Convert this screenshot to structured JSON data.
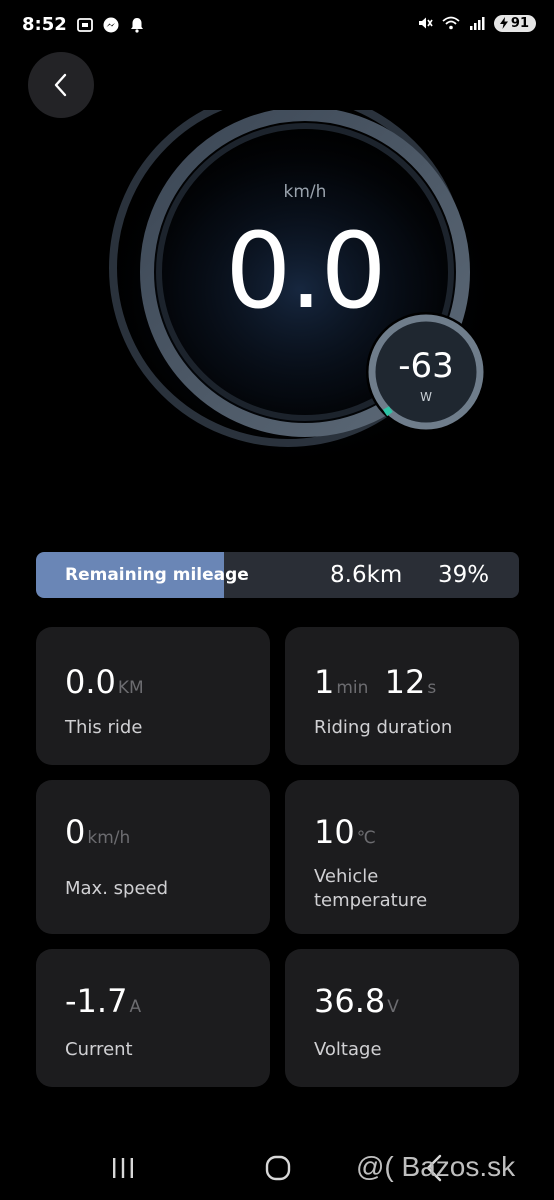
{
  "status_bar": {
    "time": "8:52",
    "battery": "91"
  },
  "gauge": {
    "speed_unit": "km/h",
    "speed_value": "0.0",
    "power_value": "-63",
    "power_unit": "W",
    "accent_color": "#2ec4a6"
  },
  "mileage": {
    "label": "Remaining mileage",
    "distance": "8.6km",
    "percent_text": "39%",
    "fill_fraction": 0.39,
    "fill_color": "#6a86b6"
  },
  "stats": [
    {
      "value": "0.0",
      "unit": "KM",
      "label": "This ride"
    },
    {
      "value": "1",
      "unit": "min",
      "value2": "12",
      "unit2": "s",
      "label": "Riding duration"
    },
    {
      "value": "0",
      "unit": "km/h",
      "label": "Max. speed"
    },
    {
      "value": "10",
      "unit": "℃",
      "label": "Vehicle temperature"
    },
    {
      "value": "-1.7",
      "unit": "A",
      "label": "Current"
    },
    {
      "value": "36.8",
      "unit": "V",
      "label": "Voltage"
    }
  ],
  "watermark": "@( Bazos.sk",
  "icons": {
    "back": "chevron-left-icon",
    "recent": "recent-apps-icon",
    "home": "home-icon",
    "nav_back": "nav-back-icon"
  }
}
